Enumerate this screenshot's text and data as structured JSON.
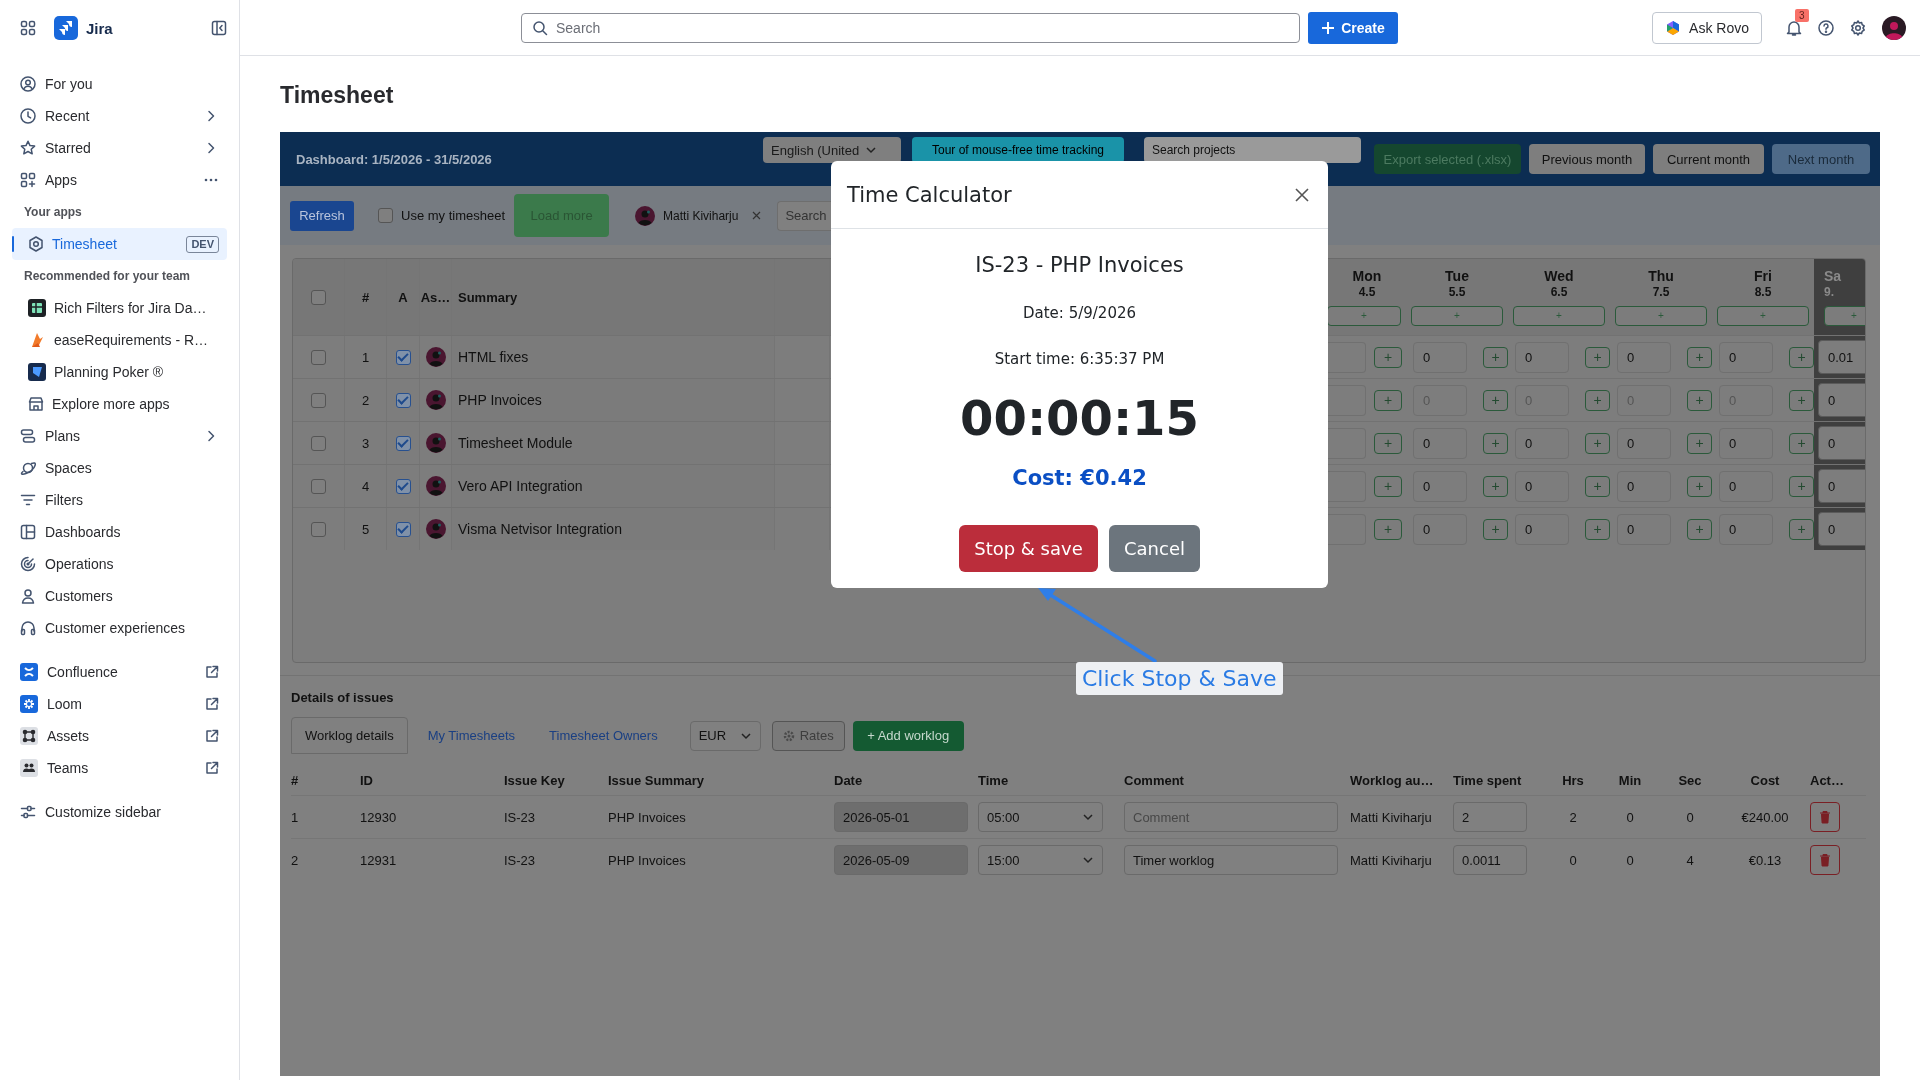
{
  "sidebar": {
    "product": "Jira",
    "items": [
      {
        "label": "For you",
        "kind": "nav",
        "selected": false
      },
      {
        "label": "Recent",
        "kind": "expand",
        "selected": false
      },
      {
        "label": "Starred",
        "kind": "expand",
        "selected": false
      },
      {
        "label": "Apps",
        "kind": "more",
        "selected": false
      },
      {
        "label": "Your apps",
        "kind": "section"
      },
      {
        "label": "Timesheet",
        "kind": "app",
        "selected": true,
        "badge": "DEV"
      },
      {
        "label": "Recommended for your team",
        "kind": "section"
      },
      {
        "label": "Rich Filters for Jira Da…",
        "kind": "app",
        "selected": false
      },
      {
        "label": "easeRequirements - R…",
        "kind": "app",
        "selected": false
      },
      {
        "label": "Planning Poker ®",
        "kind": "app",
        "selected": false
      },
      {
        "label": "Explore more apps",
        "kind": "app",
        "selected": false
      },
      {
        "label": "Plans",
        "kind": "expand",
        "selected": false
      },
      {
        "label": "Spaces",
        "kind": "nav",
        "selected": false
      },
      {
        "label": "Filters",
        "kind": "nav",
        "selected": false
      },
      {
        "label": "Dashboards",
        "kind": "nav",
        "selected": false
      },
      {
        "label": "Operations",
        "kind": "nav",
        "selected": false
      },
      {
        "label": "Customers",
        "kind": "nav",
        "selected": false
      },
      {
        "label": "Customer experiences",
        "kind": "nav",
        "selected": false
      },
      {
        "label": "Confluence",
        "kind": "external",
        "selected": false
      },
      {
        "label": "Loom",
        "kind": "external",
        "selected": false
      },
      {
        "label": "Assets",
        "kind": "external",
        "selected": false
      },
      {
        "label": "Teams",
        "kind": "external",
        "selected": false
      },
      {
        "label": "Customize sidebar",
        "kind": "nav",
        "selected": false
      }
    ]
  },
  "topbar": {
    "search_placeholder": "Search",
    "create_button": "Create",
    "ask_button": "Ask Rovo",
    "notification_count": "3"
  },
  "page_title": "Timesheet",
  "app": {
    "header": {
      "period": "Dashboard: 1/5/2026 - 31/5/2026",
      "language": "English (United",
      "tour_button": "Tour of mouse-free time tracking",
      "search_placeholder": "Search projects",
      "buttons": [
        {
          "label": "Export selected (.xlsx)",
          "kind": "export",
          "disabled": true
        },
        {
          "label": "Previous month",
          "kind": "month",
          "disabled": false
        },
        {
          "label": "Current month",
          "kind": "month",
          "disabled": false
        },
        {
          "label": "Next month",
          "kind": "month",
          "disabled": true
        }
      ]
    },
    "toolbar": {
      "refresh_button": "Refresh",
      "use_my_timesheet": {
        "label": "Use my timesheet",
        "checked": false
      },
      "load_more": {
        "label": "Load more",
        "disabled": true
      },
      "user_filter": "Matti Kiviharju",
      "search_placeholder": "Search"
    },
    "grid": {
      "add_label": "+",
      "select_all": false,
      "columns": [
        "#",
        "A",
        "As…",
        "Summary"
      ],
      "days": [
        {
          "day": "Mon",
          "date": "4.5",
          "weekend": false
        },
        {
          "day": "Tue",
          "date": "5.5",
          "weekend": false
        },
        {
          "day": "Wed",
          "date": "6.5",
          "weekend": false
        },
        {
          "day": "Thu",
          "date": "7.5",
          "weekend": false
        },
        {
          "day": "Fri",
          "date": "8.5",
          "weekend": false
        },
        {
          "day": "Sa",
          "date": "9.",
          "weekend": true
        }
      ],
      "rows": [
        {
          "selected": false,
          "number": "1",
          "approved": true,
          "summary": "HTML fixes",
          "muted": false,
          "hours": [
            "0",
            "0",
            "0",
            "0",
            "0.01"
          ]
        },
        {
          "selected": false,
          "number": "2",
          "approved": true,
          "summary": "PHP Invoices",
          "muted": true,
          "hours": [
            "0",
            "0",
            "0",
            "0",
            "0"
          ]
        },
        {
          "selected": false,
          "number": "3",
          "approved": true,
          "summary": "Timesheet Module",
          "muted": false,
          "hours": [
            "0",
            "0",
            "0",
            "0",
            "0"
          ]
        },
        {
          "selected": false,
          "number": "4",
          "approved": true,
          "summary": "Vero API Integration",
          "muted": false,
          "hours": [
            "0",
            "0",
            "0",
            "0",
            "0"
          ]
        },
        {
          "selected": false,
          "number": "5",
          "approved": true,
          "summary": "Visma Netvisor Integration",
          "muted": false,
          "hours": [
            "0",
            "0",
            "0",
            "0",
            "0"
          ]
        }
      ]
    },
    "details": {
      "title": "Details of issues",
      "tabs": [
        {
          "label": "Worklog details",
          "selected": true
        },
        {
          "label": "My Timesheets",
          "selected": false
        },
        {
          "label": "Timesheet Owners",
          "selected": false
        }
      ],
      "currency": "EUR",
      "rates_button": "Rates",
      "add_button": "+ Add worklog",
      "columns": [
        "#",
        "ID",
        "Issue Key",
        "Issue Summary",
        "Date",
        "Time",
        "Comment",
        "Worklog au…",
        "Time spent",
        "Hrs",
        "Min",
        "Sec",
        "Cost",
        "Act…"
      ],
      "rows": [
        {
          "number": "1",
          "id": "12930",
          "issue_key": "IS-23",
          "summary": "PHP Invoices",
          "date": "2026-05-01",
          "time": "05:00",
          "comment": {
            "placeholder": "Comment"
          },
          "author": "Matti Kiviharju",
          "time_spent": "2",
          "hrs": "2",
          "min": "0",
          "sec": "0",
          "cost": "€240.00"
        },
        {
          "number": "2",
          "id": "12931",
          "issue_key": "IS-23",
          "summary": "PHP Invoices",
          "date": "2026-05-09",
          "time": "15:00",
          "comment": {
            "value": "Timer worklog"
          },
          "author": "Matti Kiviharju",
          "time_spent": "0.0011",
          "hrs": "0",
          "min": "0",
          "sec": "4",
          "cost": "€0.13"
        }
      ]
    }
  },
  "modal": {
    "title": "Time Calculator",
    "issue": "IS-23 - PHP Invoices",
    "date": "Date: 5/9/2026",
    "start_time": "Start time: 6:35:37 PM",
    "timer": "00:00:15",
    "cost": "Cost: €0.42",
    "buttons": [
      {
        "label": "Stop & save",
        "kind": "danger"
      },
      {
        "label": "Cancel",
        "kind": "secondary"
      }
    ]
  },
  "callout": {
    "label": "Click Stop & Save"
  }
}
